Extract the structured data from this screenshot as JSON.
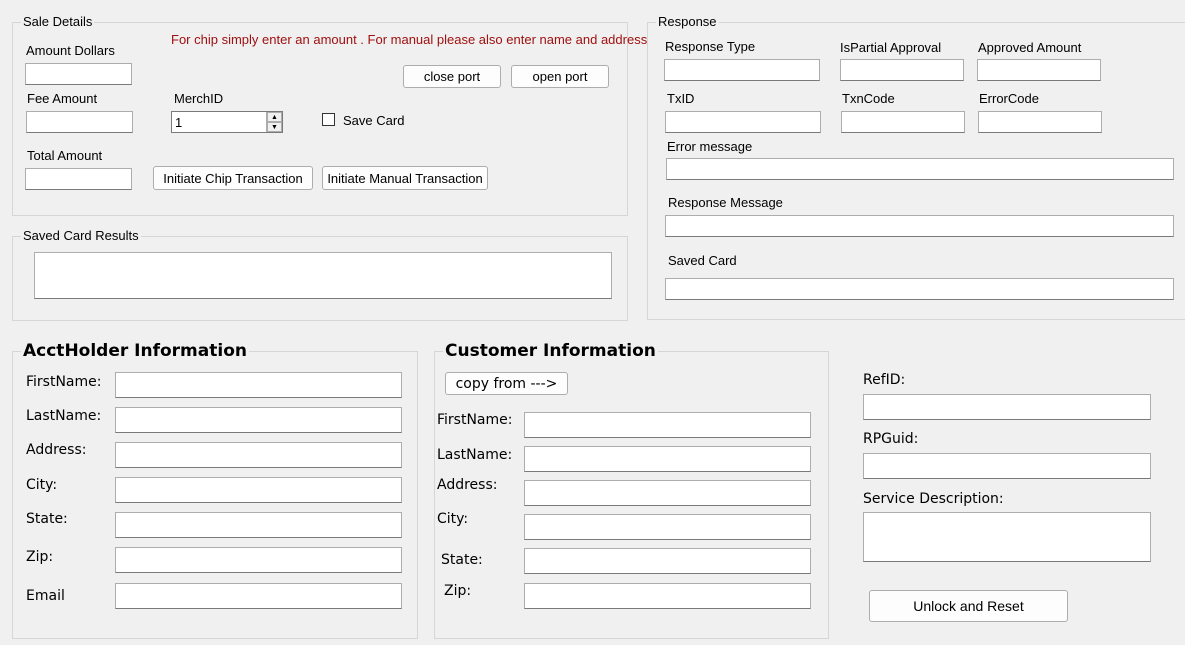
{
  "sale_details": {
    "title": "Sale Details",
    "note": "For chip simply enter an amount . For manual please also enter name and address",
    "amount_label": "Amount Dollars",
    "fee_label": "Fee Amount",
    "merch_label": "MerchID",
    "merch_value": "1",
    "save_card_label": "Save Card",
    "total_label": "Total Amount",
    "close_port": "close port",
    "open_port": "open port",
    "chip_btn": "Initiate Chip Transaction",
    "manual_btn": "Initiate Manual Transaction"
  },
  "saved_card_results": {
    "title": "Saved Card Results"
  },
  "response": {
    "title": "Response",
    "response_type": "Response Type",
    "is_partial": "IsPartial Approval",
    "approved_amount": "Approved Amount",
    "txid": "TxID",
    "txn_code": "TxnCode",
    "error_code": "ErrorCode",
    "error_message": "Error message",
    "response_message": "Response Message",
    "saved_card": "Saved Card"
  },
  "acct_holder": {
    "title": "AcctHolder Information",
    "first": "FirstName:",
    "last": "LastName:",
    "address": "Address:",
    "city": "City:",
    "state": "State:",
    "zip": "Zip:",
    "email": "Email"
  },
  "customer": {
    "title": "Customer Information",
    "copy_btn": "copy from --->",
    "first": "FirstName:",
    "last": "LastName:",
    "address": "Address:",
    "city": "City:",
    "state": "State:",
    "zip": "Zip:"
  },
  "extra": {
    "refid": "RefID:",
    "rpguid": "RPGuid:",
    "service_desc": "Service Description:",
    "unlock_btn": "Unlock and Reset"
  }
}
